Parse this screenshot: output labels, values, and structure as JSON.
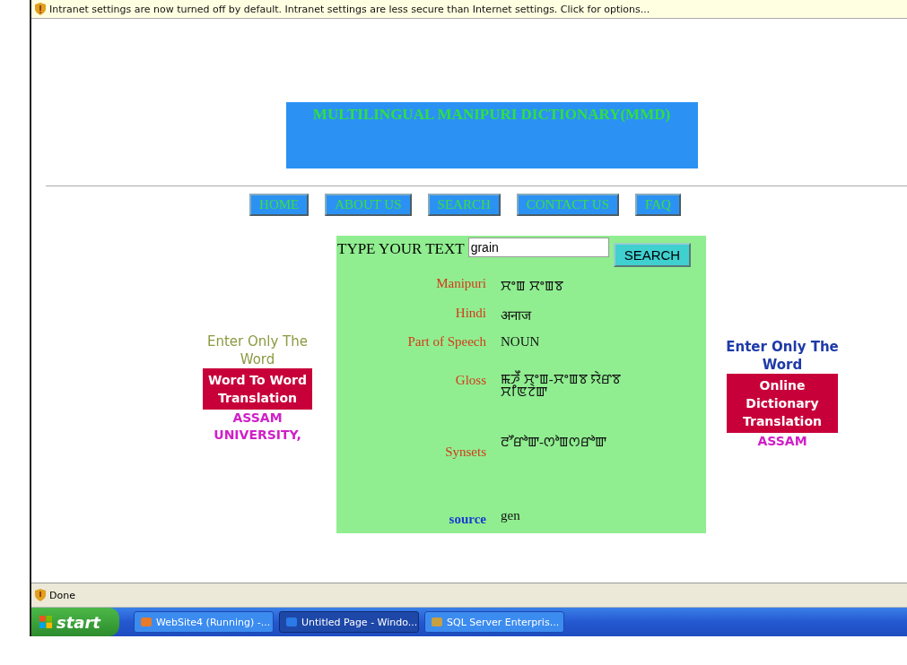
{
  "info_bar": {
    "text": "Intranet settings are now turned off by default. Intranet settings are less secure than Internet settings. Click for options..."
  },
  "header": {
    "title": "MULTILINGUAL MANIPURI DICTIONARY(MMD)"
  },
  "nav": [
    {
      "label": "HOME"
    },
    {
      "label": "ABOUT US"
    },
    {
      "label": "SEARCH"
    },
    {
      "label": "CONTACT US"
    },
    {
      "label": "FAQ"
    }
  ],
  "left_promo": {
    "hint": "Enter Only The Word",
    "button": "Word To Word Translation",
    "footer": "ASSAM UNIVERSITY,"
  },
  "search": {
    "label": "TYPE YOUR TEXT",
    "value": "grain",
    "button": "SEARCH"
  },
  "results": [
    {
      "kind": "field",
      "label": "Manipuri",
      "value": "ꯆꯦꯡ ꯆꯦꯡꯕ"
    },
    {
      "kind": "field",
      "label": "Hindi",
      "value": "अनाज"
    },
    {
      "kind": "field",
      "label": "Part of Speech",
      "value": "NOUN"
    },
    {
      "kind": "field",
      "label": "Gloss",
      "value": "ꯃꯍꯩ ꯆꯦꯡ-ꯆꯦꯡꯕ ꯌꯥꯔꯕ ꯆꯤꯟꯖꯥꯛ"
    },
    {
      "kind": "field",
      "label": "Synsets",
      "value": "ꯂꯧꯔꯣꯛ-ꯁꯣꯡꯁꯔꯣꯛ"
    },
    {
      "kind": "source",
      "label": "source",
      "value": "gen"
    }
  ],
  "right_promo": {
    "hint": "Enter Only The Word",
    "button": "Online Dictionary Translation",
    "footer": "ASSAM"
  },
  "status_bar": {
    "text": "Done"
  },
  "taskbar": {
    "start": "start",
    "tasks": [
      {
        "label": "WebSite4 (Running) -...",
        "selected": false
      },
      {
        "label": "Untitled Page - Windo...",
        "selected": true
      },
      {
        "label": "SQL Server Enterpris...",
        "selected": false
      }
    ]
  }
}
